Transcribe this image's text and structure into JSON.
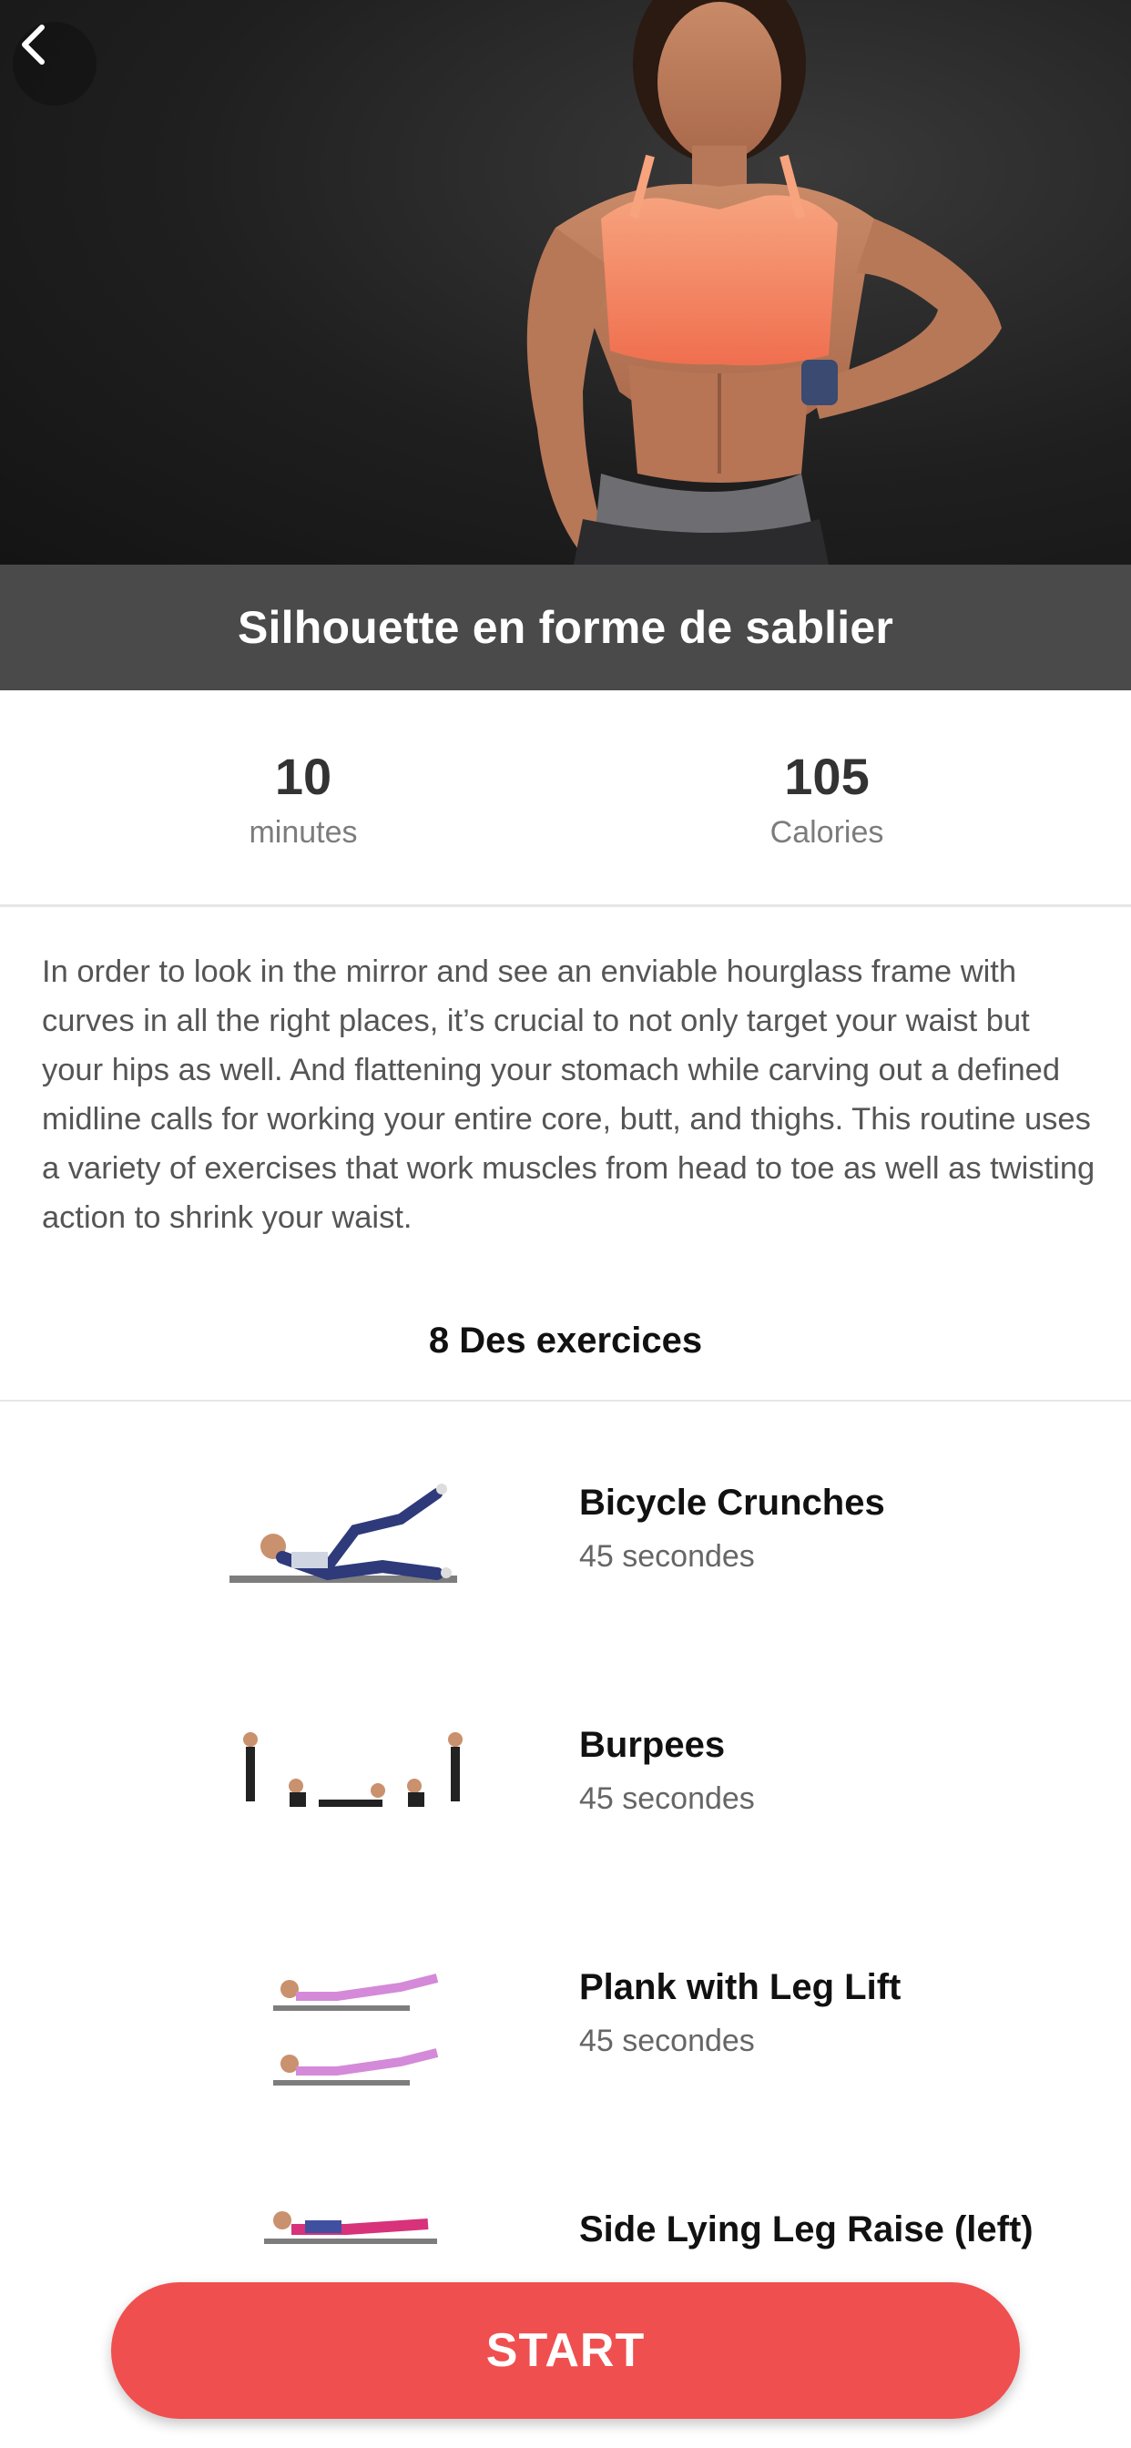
{
  "workout": {
    "title": "Silhouette en forme de sablier"
  },
  "stats": {
    "minutes_value": "10",
    "minutes_label": "minutes",
    "calories_value": "105",
    "calories_label": "Calories"
  },
  "description": "In order to look in the mirror and see an enviable hourglass frame with curves in all the right places, it’s crucial to not only target your waist but your hips as well. And flattening your stomach while carving out a defined midline calls for working your entire core, butt, and thighs. This routine uses a variety of exercises that work muscles from head to toe as well as twisting action to shrink your waist.",
  "exercises_header": "8 Des exercices",
  "exercises": [
    {
      "name": "Bicycle Crunches",
      "duration": "45 secondes",
      "icon": "bicycle-crunches-illustration"
    },
    {
      "name": "Burpees",
      "duration": "45 secondes",
      "icon": "burpees-illustration"
    },
    {
      "name": "Plank with Leg Lift",
      "duration": "45 secondes",
      "icon": "plank-leg-lift-illustration"
    },
    {
      "name": "Side Lying Leg Raise (left)",
      "duration": "",
      "icon": "side-leg-raise-illustration"
    }
  ],
  "buttons": {
    "start": "START",
    "back_icon": "chevron-left-icon"
  },
  "colors": {
    "accent": "#f04f4f",
    "title_band": "#4a4a4a",
    "hero_top": "#f58c6a"
  }
}
